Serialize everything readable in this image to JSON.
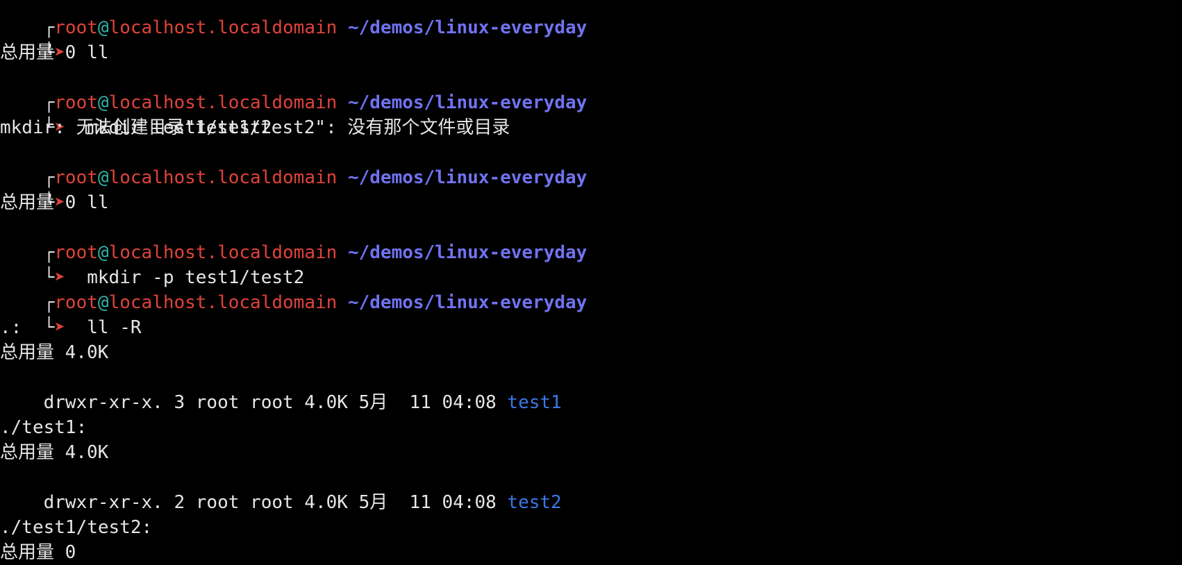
{
  "theme": {
    "background": "#000000",
    "prompt_user_color": "#e0433a",
    "prompt_at_color": "#2fb6a7",
    "prompt_path_color": "#7073f0",
    "directory_color": "#3a78e6",
    "text_color": "#e6e6e6"
  },
  "prompt": {
    "user": "root",
    "at": "@",
    "host": "localhost.localdomain",
    "path": "~/demos/linux-everyday"
  },
  "lines": {
    "cmd1": "ll",
    "out1": "总用量 0",
    "cmd2": "mkdir test1/test2",
    "out2": "mkdir: 无法创建目录\"test1/test2\": 没有那个文件或目录",
    "cmd3": "ll",
    "out3": "总用量 0",
    "cmd4": "mkdir -p test1/test2",
    "cmd5": "ll -R",
    "out5_dir_root": ".:",
    "out5_total_root": "总用量 4.0K",
    "out5_entry1_meta": "drwxr-xr-x. 3 root root 4.0K 5月  11 04:08",
    "out5_entry1_name": "test1",
    "out5_dir_test1": "./test1:",
    "out5_total_test1": "总用量 4.0K",
    "out5_entry2_meta": "drwxr-xr-x. 2 root root 4.0K 5月  11 04:08",
    "out5_entry2_name": "test2",
    "out5_dir_test2": "./test1/test2:",
    "out5_total_test2": "总用量 0"
  },
  "icons": {
    "prompt_corner": "box-corner-icon",
    "prompt_arrow": "right-arrow-icon"
  }
}
